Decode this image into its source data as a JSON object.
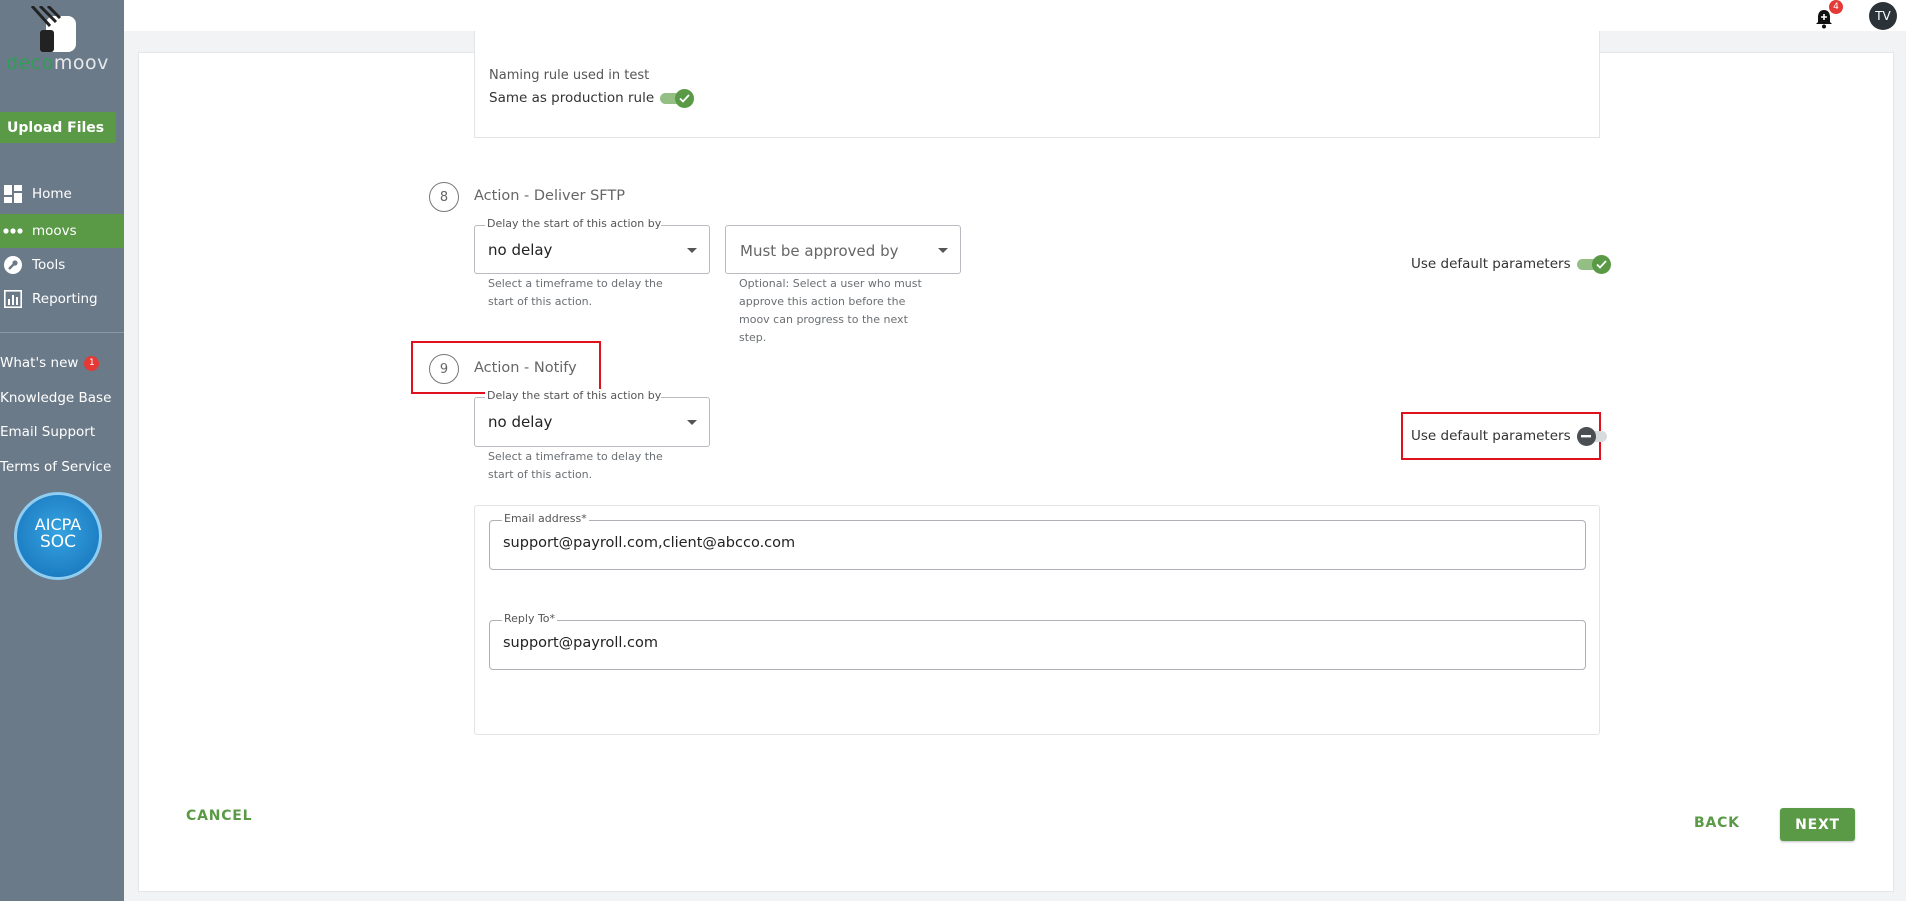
{
  "sidebar": {
    "logo_text_part1": "deco",
    "logo_text_part2": "moov",
    "upload_button": "Upload Files",
    "nav": [
      {
        "label": "Home",
        "icon": "dashboard-icon"
      },
      {
        "label": "moovs",
        "icon": "dots-icon",
        "active": true
      },
      {
        "label": "Tools",
        "icon": "wrench-icon"
      },
      {
        "label": "Reporting",
        "icon": "bar-chart-icon"
      }
    ],
    "links": {
      "whats_new": "What's new",
      "whats_new_badge": "1",
      "knowledge_base": "Knowledge Base",
      "email_support": "Email Support",
      "terms": "Terms of Service"
    },
    "aicpa": {
      "line1": "AICPA",
      "line2": "SOC"
    }
  },
  "topbar": {
    "notification_count": "4",
    "avatar_initials": "TV"
  },
  "naming": {
    "label": "Naming rule used in test",
    "same_as_production": "Same as production rule",
    "same_as_production_on": true
  },
  "step8": {
    "number": "8",
    "title": "Action - Deliver SFTP",
    "delay_legend": "Delay the start of this action by",
    "delay_value": "no delay",
    "delay_helper_1": "Select a timeframe to delay the",
    "delay_helper_2": "start of this action.",
    "approval_placeholder": "Must be approved by",
    "approval_helper_1": "Optional: Select a user who must",
    "approval_helper_2": "approve this action before the",
    "approval_helper_3": "moov can progress to the next",
    "approval_helper_4": "step.",
    "use_default_label": "Use default parameters",
    "use_default_on": true
  },
  "step9": {
    "number": "9",
    "title": "Action - Notify",
    "delay_legend": "Delay the start of this action by",
    "delay_value": "no delay",
    "delay_helper_1": "Select a timeframe to delay the",
    "delay_helper_2": "start of this action.",
    "use_default_label": "Use default parameters",
    "use_default_on": false,
    "email_legend": "Email address*",
    "email_value": "support@payroll.com,client@abcco.com",
    "reply_legend": "Reply To*",
    "reply_value": "support@payroll.com"
  },
  "footer": {
    "cancel": "CANCEL",
    "back": "BACK",
    "next": "NEXT"
  },
  "colors": {
    "accent": "#5a9a47",
    "sidebar": "#6b7a89",
    "highlight": "#e0101d"
  }
}
